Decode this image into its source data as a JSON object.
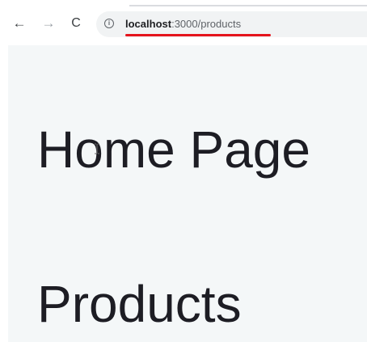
{
  "browser": {
    "nav": {
      "back_icon": "←",
      "forward_icon": "→",
      "reload_icon": "C"
    },
    "address_bar": {
      "info_icon": "i",
      "url_host": "localhost",
      "url_path": ":3000/products"
    },
    "accent_colors": {
      "underline": "#e5141c"
    }
  },
  "page": {
    "home_heading": "Home Page",
    "products_heading": "Products"
  }
}
